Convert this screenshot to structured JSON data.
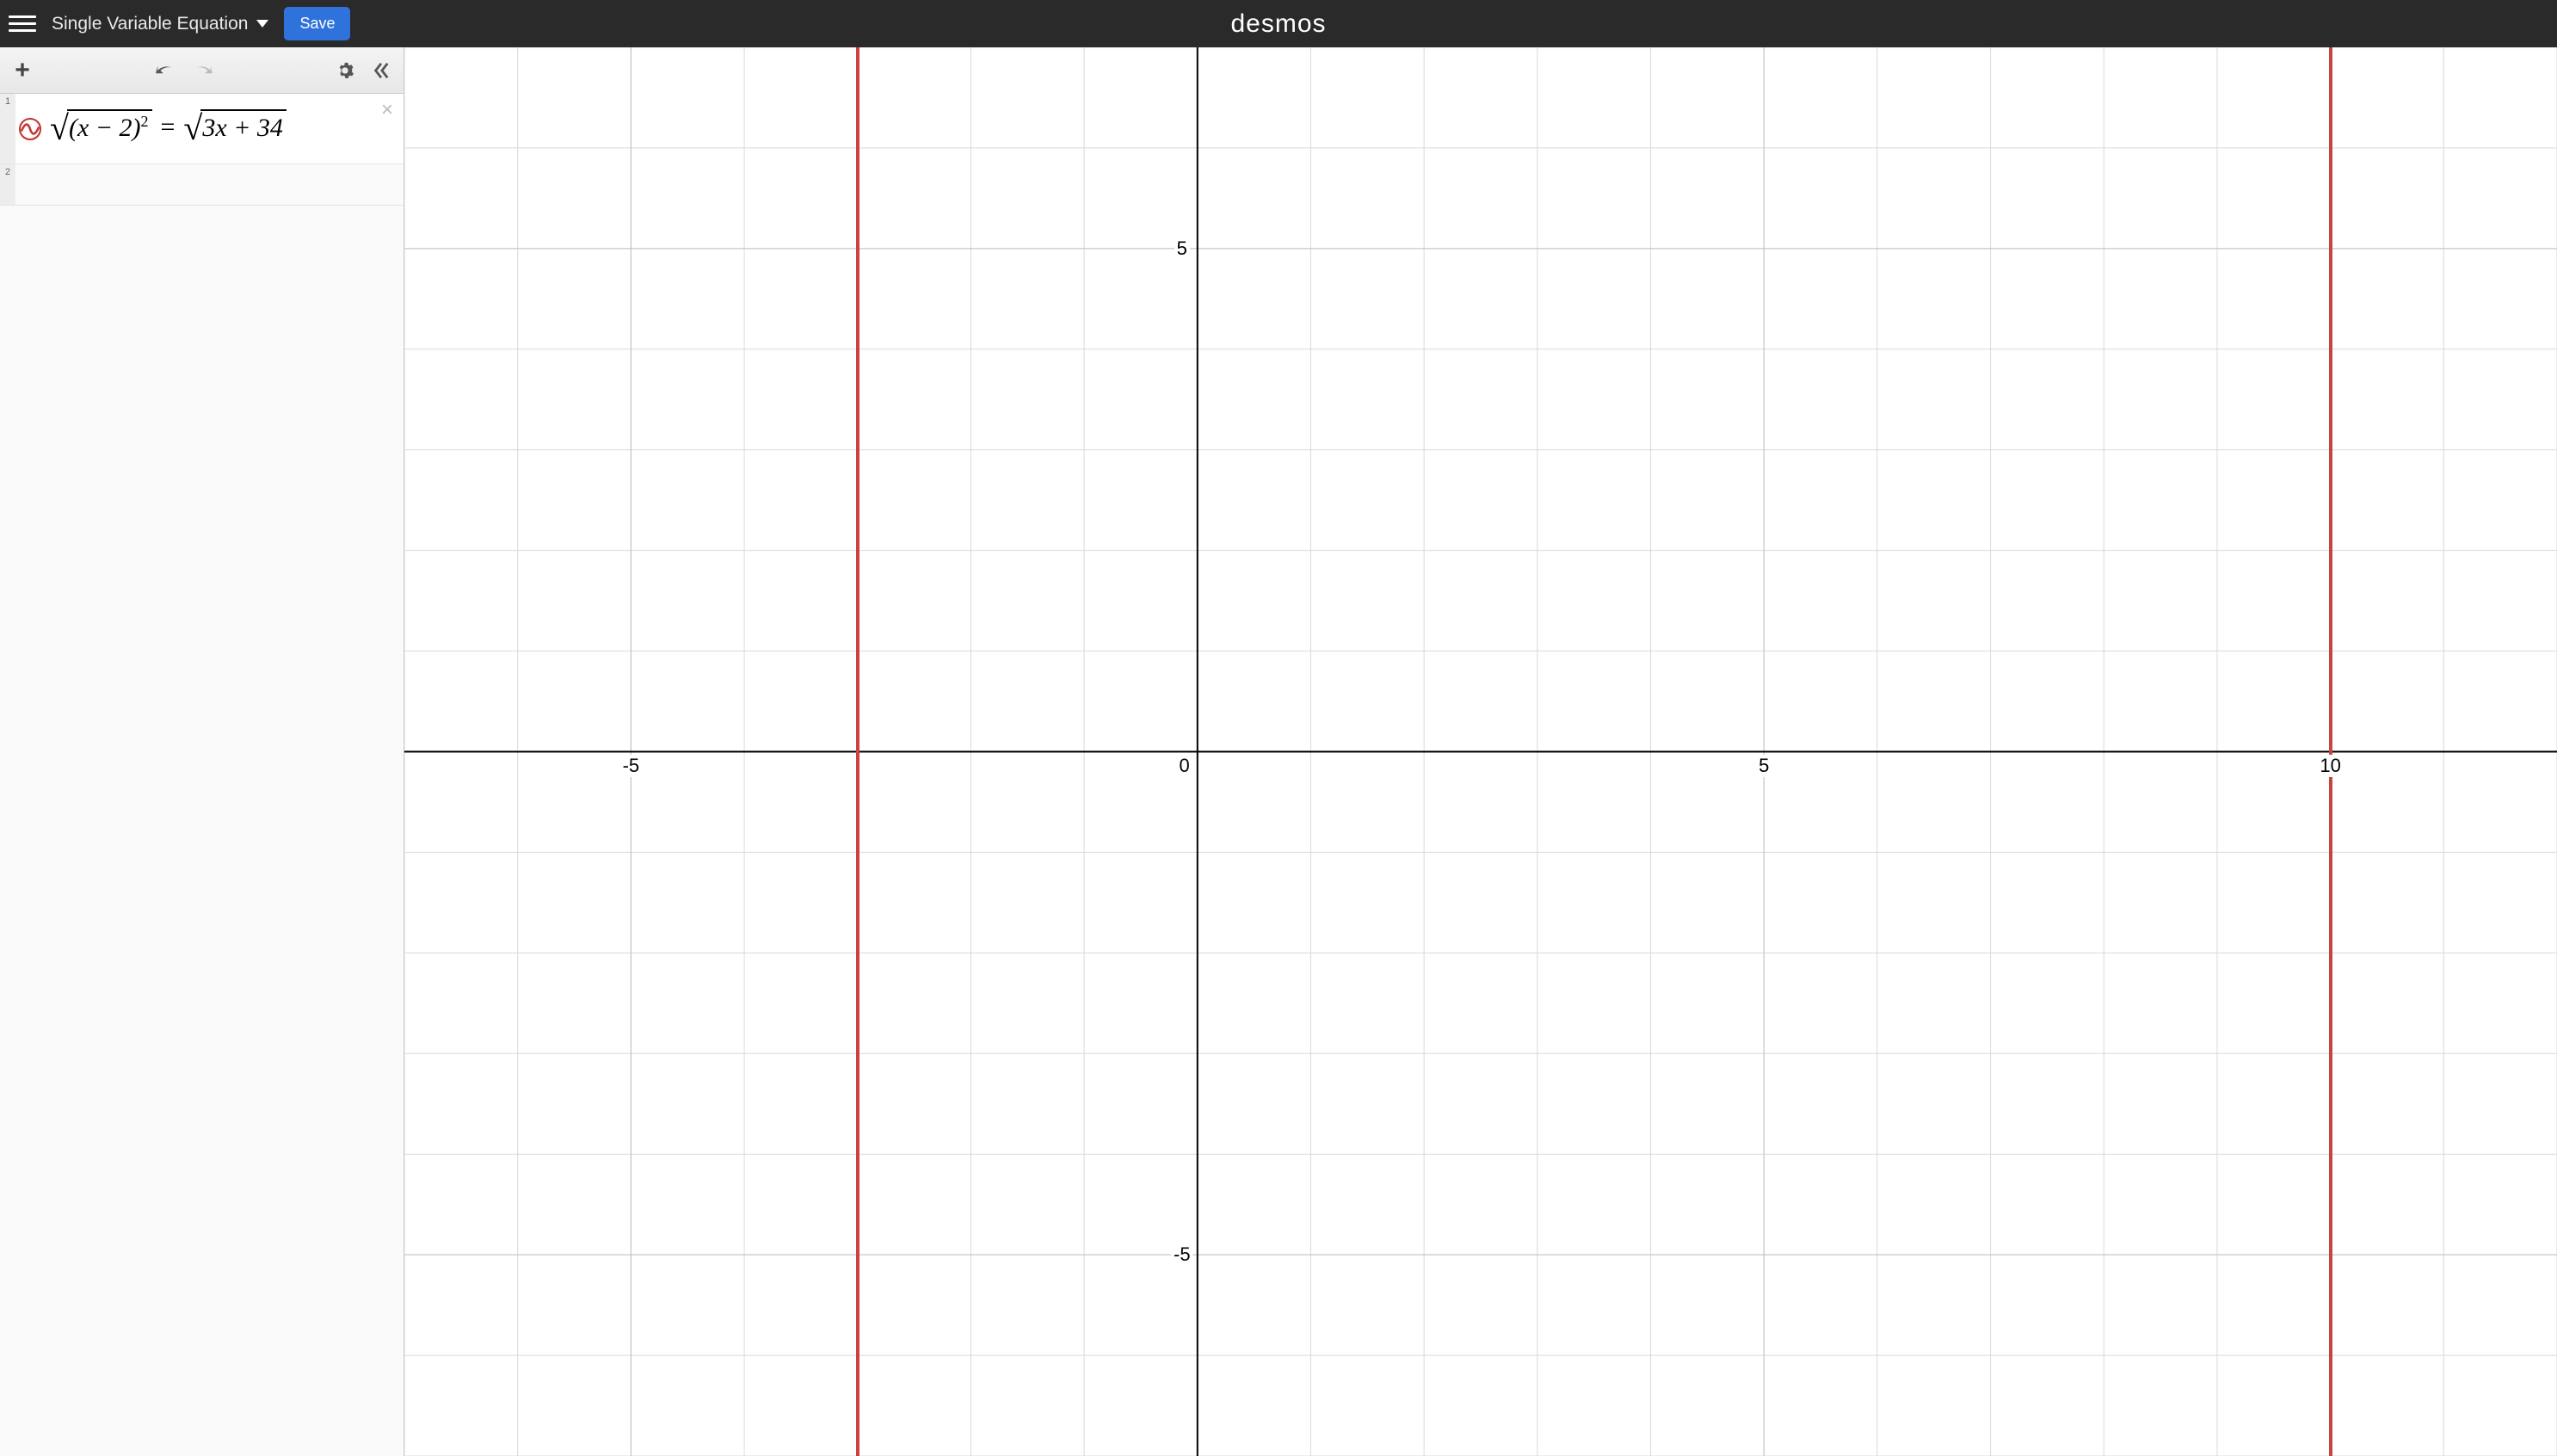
{
  "header": {
    "title": "Single Variable Equation",
    "save_label": "Save",
    "logo": "desmos"
  },
  "sidebar": {
    "expressions": [
      {
        "index": "1",
        "kind": "equation",
        "latex": "\\sqrt{(x-2)^2}=\\sqrt{3x+34}",
        "radicand_left": "(x − 2)",
        "exponent_left": "2",
        "eq": "=",
        "radicand_right": "3x + 34",
        "color": "#c74440"
      },
      {
        "index": "2",
        "kind": "empty"
      }
    ]
  },
  "chart_data": {
    "type": "line",
    "title": "",
    "xlabel": "",
    "ylabel": "",
    "xlim": [
      -7,
      12
    ],
    "ylim": [
      -7,
      7
    ],
    "x_ticks": [
      -5,
      0,
      5,
      10
    ],
    "y_ticks": [
      -5,
      5
    ],
    "gridlines_minor_step": 1,
    "gridlines_major_step": 5,
    "series": [
      {
        "name": "solution x = -3",
        "type": "vertical-line",
        "x": -3,
        "color": "#c74440"
      },
      {
        "name": "solution x = 10",
        "type": "vertical-line",
        "x": 10,
        "color": "#c74440"
      }
    ],
    "x_tick_labels": {
      "-5": "-5",
      "0": "0",
      "5": "5",
      "10": "10"
    },
    "y_tick_labels": {
      "-5": "-5",
      "5": "5"
    }
  }
}
